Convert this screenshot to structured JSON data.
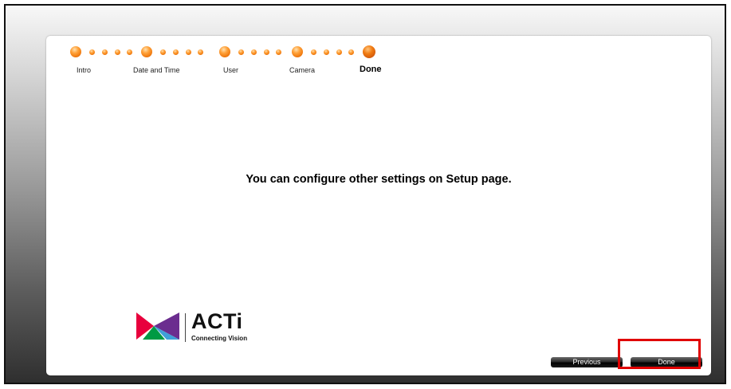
{
  "wizard": {
    "steps": [
      {
        "label": "Intro",
        "state": "completed"
      },
      {
        "label": "Date and Time",
        "state": "completed"
      },
      {
        "label": "User",
        "state": "completed"
      },
      {
        "label": "Camera",
        "state": "completed"
      },
      {
        "label": "Done",
        "state": "current"
      }
    ]
  },
  "main": {
    "message": "You can configure other settings on Setup page."
  },
  "brand": {
    "name": "ACTi",
    "tagline": "Connecting Vision",
    "logo_colors": [
      "#e8003d",
      "#f39800",
      "#009a44",
      "#6b2d8f"
    ]
  },
  "buttons": {
    "previous_label": "Previous",
    "done_label": "Done"
  },
  "colors": {
    "progress_dot": "#f07a10",
    "highlight": "#e00000"
  }
}
